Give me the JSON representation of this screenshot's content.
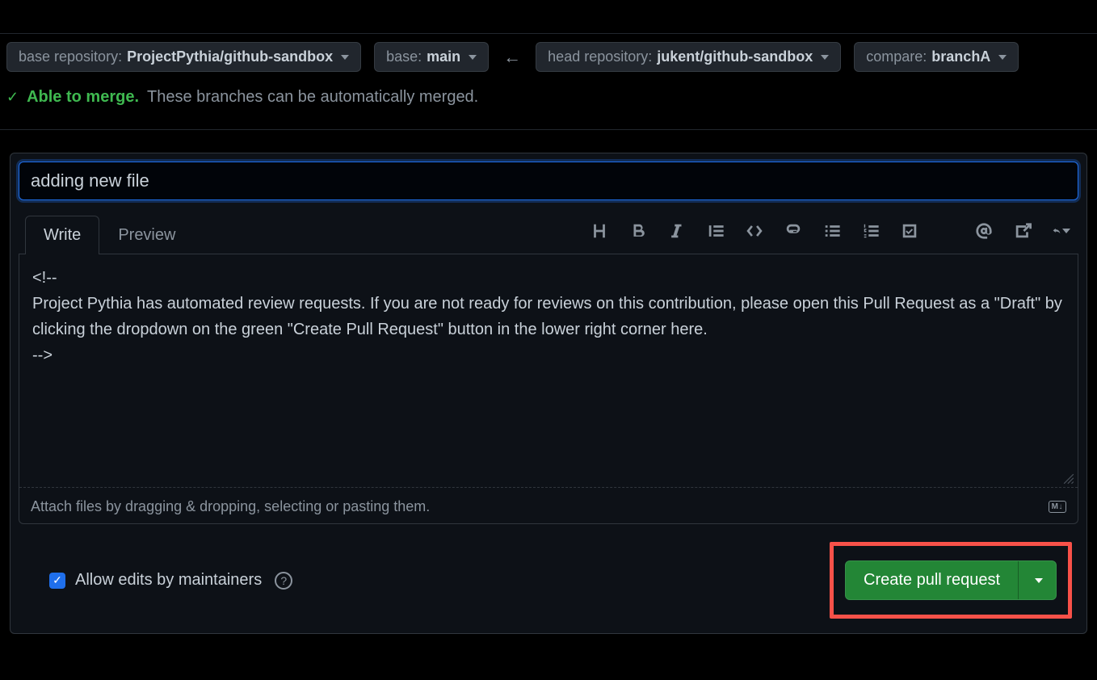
{
  "baseRepo": {
    "label": "base repository:",
    "value": "ProjectPythia/github-sandbox"
  },
  "baseBranch": {
    "label": "base:",
    "value": "main"
  },
  "headRepo": {
    "label": "head repository:",
    "value": "jukent/github-sandbox"
  },
  "compareBranch": {
    "label": "compare:",
    "value": "branchA"
  },
  "mergeStatus": {
    "able": "Able to merge.",
    "auto": "These branches can be automatically merged."
  },
  "title": "adding new file",
  "tabs": {
    "write": "Write",
    "preview": "Preview"
  },
  "body": "<!--\nProject Pythia has automated review requests. If you are not ready for reviews on this contribution, please open this Pull Request as a \"Draft\" by clicking the dropdown on the green \"Create Pull Request\" button in the lower right corner here.\n-->",
  "attachHint": "Attach files by dragging & dropping, selecting or pasting them.",
  "mdBadge": "M↓",
  "allowEditsLabel": "Allow edits by maintainers",
  "submitLabel": "Create pull request"
}
